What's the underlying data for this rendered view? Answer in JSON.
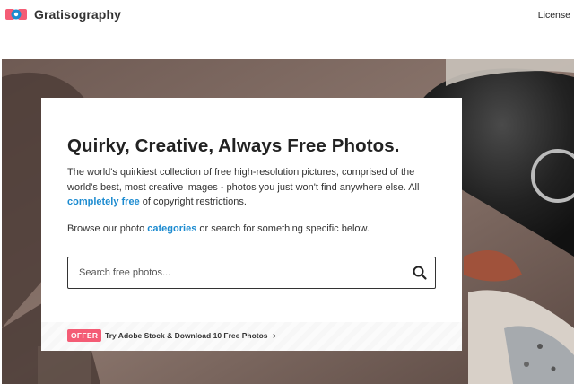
{
  "header": {
    "logo_text": "Gratisography",
    "license_label": "License"
  },
  "hero": {
    "title": "Quirky, Creative, Always Free Photos.",
    "description_part1": "The world's quirkiest collection of free high-resolution pictures, comprised of the world's best, most creative images - photos you just won't find anywhere else. All ",
    "description_link": "completely free",
    "description_part2": " of copyright restrictions.",
    "browse_part1": "Browse our photo ",
    "browse_link": "categories",
    "browse_part2": " or search for something specific below.",
    "search_placeholder": "Search free photos...",
    "search_value": ""
  },
  "offer": {
    "badge": "OFFER",
    "text": "Try Adobe Stock & Download 10 Free Photos",
    "arrow": "➔"
  },
  "colors": {
    "accent_link": "#1c8bd0",
    "offer_badge": "#f45c75",
    "logo_red": "#f45c75",
    "logo_blue": "#1c8bd0"
  }
}
